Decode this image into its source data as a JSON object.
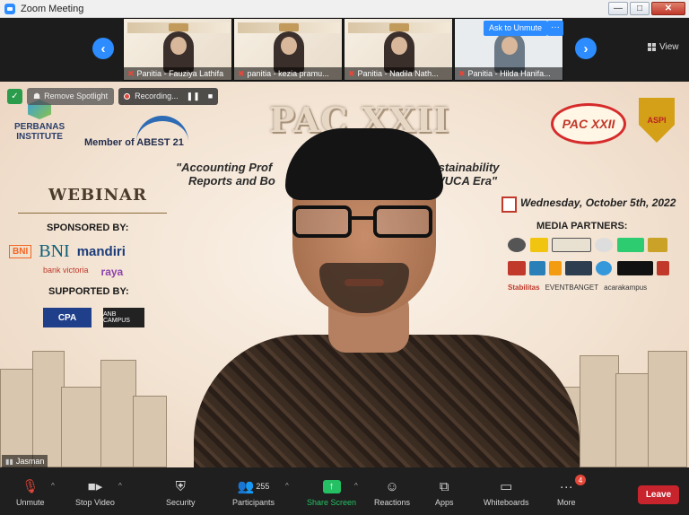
{
  "window": {
    "title": "Zoom Meeting",
    "min": "—",
    "max": "□",
    "close": "✕"
  },
  "strip": {
    "prev": "‹",
    "next": "›",
    "thumbs": [
      {
        "name": "Panitia - Fauziya Lathifa"
      },
      {
        "name": "panitia - kezia pramu..."
      },
      {
        "name": "Panitia - Nadila Nath..."
      },
      {
        "name": "Panitia - Hilda Hanifa..."
      }
    ],
    "ask_to_unmute": "Ask to Unmute",
    "more": "···",
    "view": "View"
  },
  "main": {
    "remove_spotlight": "Remove Spotlight",
    "recording": "Recording...",
    "pause": "❚❚",
    "stop": "■",
    "participant_name": "Jasman"
  },
  "slide": {
    "institute_l1": "PERBANAS",
    "institute_l2": "INSTITUTE",
    "abest": "Member of ABEST 21",
    "title": "PAC XXII",
    "theme_l1_left": "\"Accounting Prof",
    "theme_l1_right": "Sustainability",
    "theme_l2_left": "Reports and Bo",
    "theme_l2_right": "VUCA Era\"",
    "pac_logo": "PAC XXII",
    "aspi_logo": "ASPI",
    "webinar": "WEBINAR",
    "sponsored_by": "SPONSORED BY:",
    "bni_small": "BNI",
    "bni_big": "BNI",
    "mandiri": "mandiri",
    "bank_victoria": "bank victoria",
    "raya": "raya",
    "supported_by": "SUPPORTED BY:",
    "cpa": "CPA",
    "anb": "ANB CAMPUS",
    "date": "Wednesday, October 5th, 2022",
    "media_partners": "MEDIA PARTNERS:",
    "media_row3_a": "Stabilitas",
    "media_row3_b": "EVENTBANGET",
    "media_row3_c": "acarakampus"
  },
  "toolbar": {
    "unmute": "Unmute",
    "stop_video": "Stop Video",
    "security": "Security",
    "participants": "Participants",
    "participants_count": "255",
    "share_screen": "Share Screen",
    "reactions": "Reactions",
    "apps": "Apps",
    "whiteboards": "Whiteboards",
    "more": "More",
    "more_badge": "4",
    "leave": "Leave"
  },
  "colors": {
    "accent": "#2d8cff",
    "share": "#24c063",
    "leave": "#c7242d",
    "alert": "#e5483a"
  }
}
